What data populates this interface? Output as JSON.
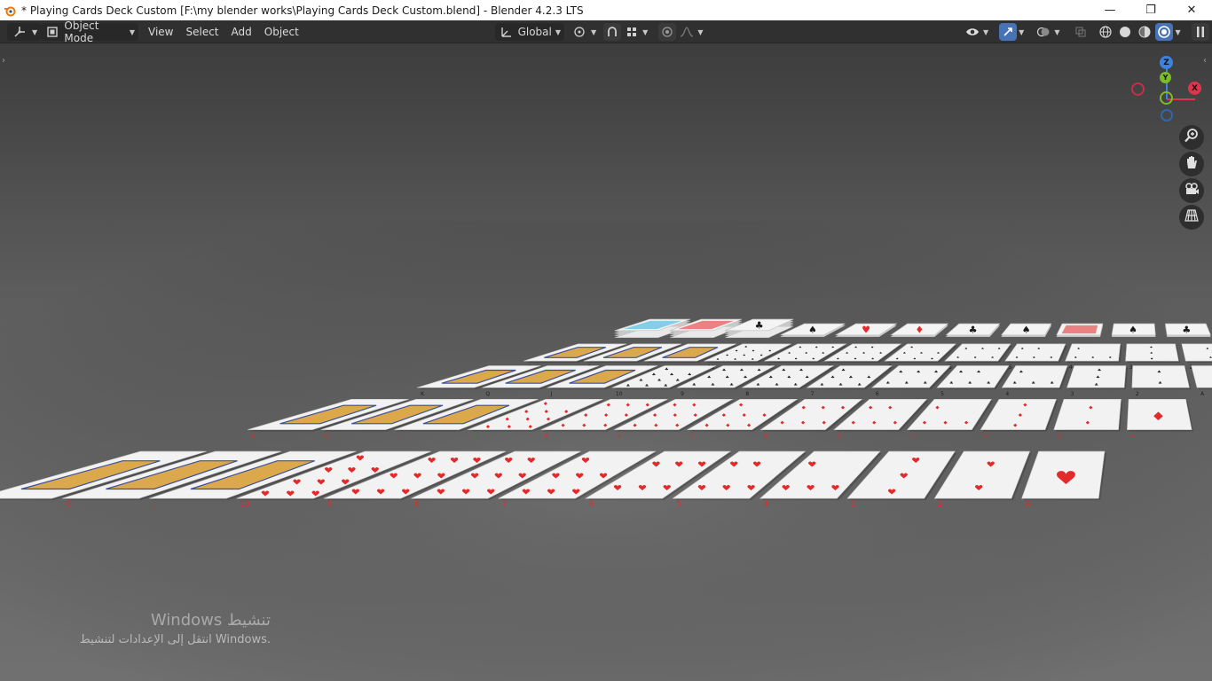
{
  "window": {
    "title": "* Playing Cards Deck Custom [F:\\my blender works\\Playing Cards Deck Custom.blend] - Blender 4.2.3 LTS",
    "minimize_glyph": "—",
    "maximize_glyph": "❐",
    "close_glyph": "✕"
  },
  "header": {
    "mode_label": "Object Mode",
    "menus": [
      "View",
      "Select",
      "Add",
      "Object"
    ],
    "orientation_label": "Global"
  },
  "gizmo": {
    "z_label": "Z",
    "y_label": "Y",
    "x_label": "X"
  },
  "watermark": {
    "title": "Windows تنشيط",
    "subtitle": "انتقل إلى الإعدادات لتنشيط Windows."
  },
  "colors": {
    "header_bg": "#303030",
    "accent": "#4772b3",
    "axis_x": "#e2334d",
    "axis_y": "#7bbd29",
    "axis_z": "#3d82e0",
    "card_face": "#f2f2f2",
    "suit_red": "#e22a2a",
    "suit_black": "#1a1a1a"
  },
  "scene": {
    "rows": [
      {
        "suit": "hearts",
        "ranks": [
          "K",
          "Q",
          "J",
          "10",
          "9",
          "8",
          "7",
          "6",
          "5",
          "4",
          "3",
          "2",
          "A"
        ]
      },
      {
        "suit": "diamonds",
        "ranks": [
          "K",
          "Q",
          "J",
          "10",
          "9",
          "8",
          "7",
          "6",
          "5",
          "4",
          "3",
          "2",
          "A"
        ]
      },
      {
        "suit": "clubs",
        "ranks": [
          "K",
          "Q",
          "J",
          "10",
          "9",
          "8",
          "7",
          "6",
          "5",
          "4",
          "3",
          "2",
          "A"
        ]
      },
      {
        "suit": "spades",
        "ranks": [
          "K",
          "Q",
          "J",
          "10",
          "9",
          "8",
          "7",
          "6",
          "5",
          "4",
          "3",
          "2",
          "A"
        ]
      }
    ],
    "decks": [
      {
        "type": "back",
        "color": "#6ec7e6"
      },
      {
        "type": "back",
        "color": "#e96d6d"
      },
      {
        "type": "face",
        "suit": "clubs"
      },
      {
        "type": "face",
        "suit": "spades"
      },
      {
        "type": "face",
        "suit": "hearts"
      },
      {
        "type": "face",
        "suit": "diamonds"
      },
      {
        "type": "face",
        "suit": "clubs"
      },
      {
        "type": "face",
        "suit": "spades"
      },
      {
        "type": "back",
        "color": "#e96d6d"
      },
      {
        "type": "face",
        "suit": "spades"
      },
      {
        "type": "face",
        "suit": "clubs"
      }
    ]
  }
}
